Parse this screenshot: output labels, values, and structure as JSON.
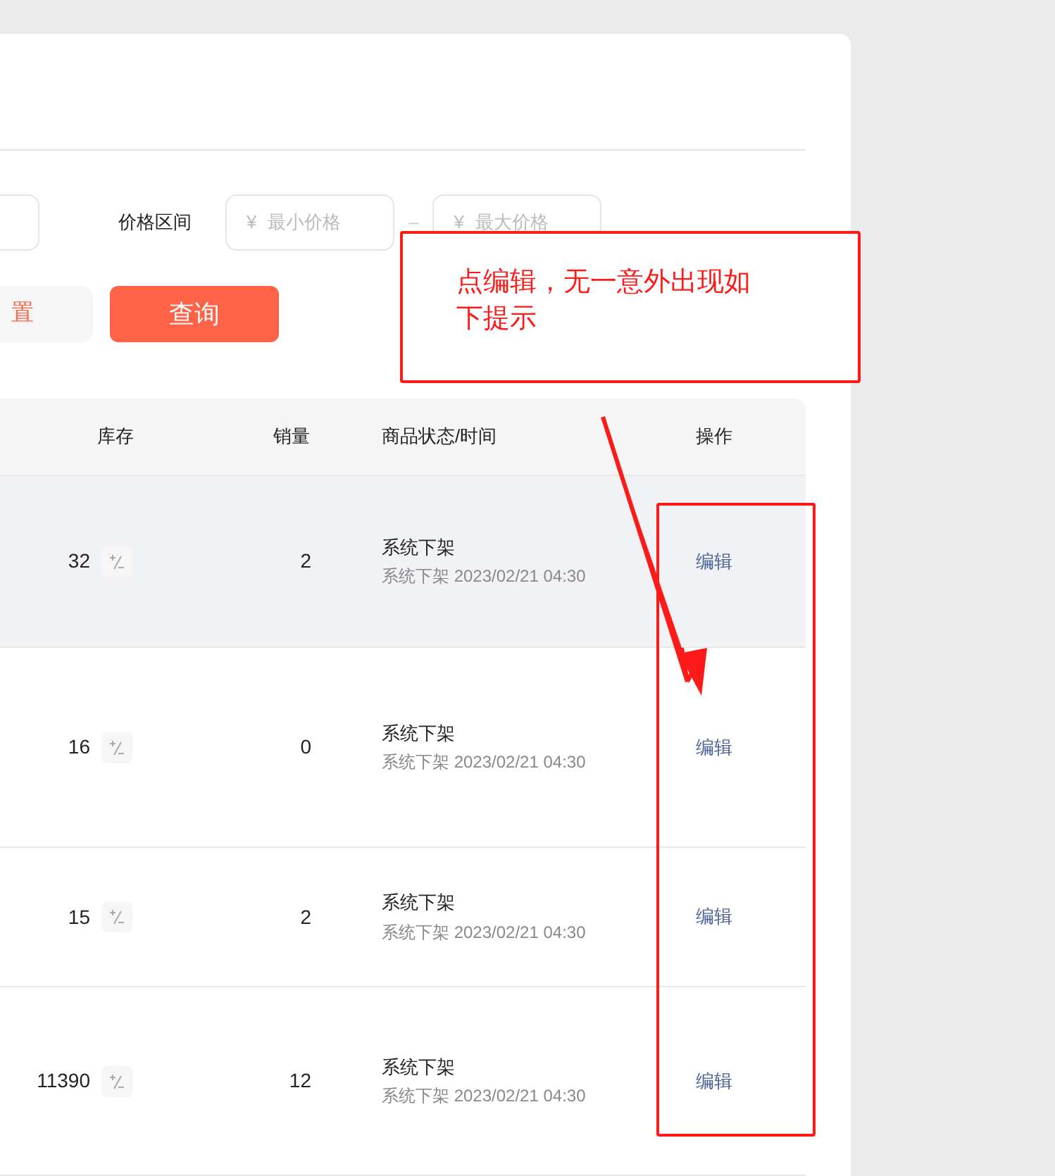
{
  "filters": {
    "price_range": {
      "label": "价格区间",
      "currency": "¥",
      "min_placeholder": "最小价格",
      "separator": "–",
      "currency_max": "¥",
      "max_placeholder": "最大价格"
    }
  },
  "buttons": {
    "reset": "置",
    "query": "查询"
  },
  "table": {
    "columns": [
      "库存",
      "销量",
      "商品状态/时间",
      "操作"
    ],
    "rows": [
      {
        "stock": "32",
        "sales": "2",
        "status": "系统下架",
        "status_detail": "系统下架 2023/02/21 04:30",
        "action": "编辑",
        "highlighted": true
      },
      {
        "stock": "16",
        "sales": "0",
        "status": "系统下架",
        "status_detail": "系统下架 2023/02/21 04:30",
        "action": "编辑",
        "highlighted": false
      },
      {
        "stock": "15",
        "sales": "2",
        "status": "系统下架",
        "status_detail": "系统下架 2023/02/21 04:30",
        "action": "编辑",
        "highlighted": false
      },
      {
        "stock": "11390",
        "sales": "12",
        "status": "系统下架",
        "status_detail": "系统下架 2023/02/21 04:30",
        "action": "编辑",
        "highlighted": false
      }
    ]
  },
  "annotation": {
    "note": "点编辑，无一意外出现如下提示"
  }
}
